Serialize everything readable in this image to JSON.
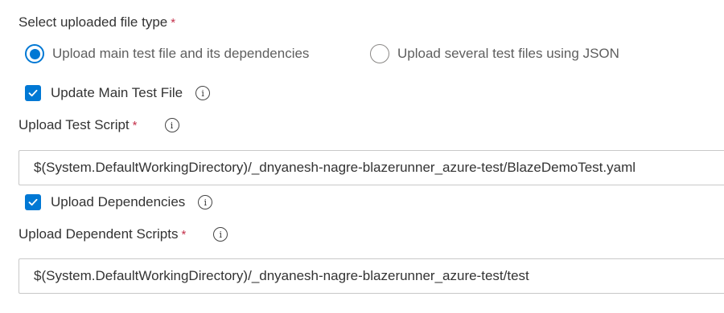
{
  "file_type": {
    "label": "Select uploaded file type",
    "required_mark": "*",
    "options": [
      {
        "label": "Upload main test file and its dependencies",
        "selected": true
      },
      {
        "label": "Upload several test files using JSON",
        "selected": false
      }
    ]
  },
  "update_main_test_file": {
    "label": "Update Main Test File",
    "checked": true,
    "info_icon": "info-icon"
  },
  "test_script": {
    "label": "Upload Test Script",
    "required_mark": "*",
    "info_icon": "info-icon",
    "value": "$(System.DefaultWorkingDirectory)/_dnyanesh-nagre-blazerunner_azure-test/BlazeDemoTest.yaml"
  },
  "upload_dependencies": {
    "label": "Upload Dependencies",
    "checked": true,
    "info_icon": "info-icon"
  },
  "dependent_scripts": {
    "label": "Upload Dependent Scripts",
    "required_mark": "*",
    "info_icon": "info-icon",
    "value": "$(System.DefaultWorkingDirectory)/_dnyanesh-nagre-blazerunner_azure-test/test"
  },
  "colors": {
    "accent": "#0078d4",
    "required": "#c4314b",
    "text": "#333333",
    "muted_text": "#5e5e5e",
    "border": "#c8c8c8"
  }
}
